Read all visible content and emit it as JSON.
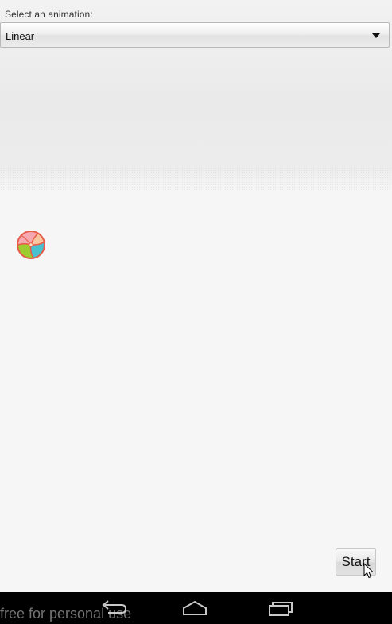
{
  "select": {
    "label": "Select an animation:",
    "value": "Linear",
    "icon": "chevron-down-icon"
  },
  "ball": {
    "icon": "beach-ball-icon"
  },
  "button": {
    "start_label": "Start"
  },
  "navbar": {
    "back_icon": "back-icon",
    "home_icon": "home-icon",
    "recent_icon": "recent-apps-icon"
  },
  "watermark": {
    "text": "free for personal use"
  },
  "colors": {
    "background": "#f6f6f6",
    "navbar": "#000000",
    "ball_red": "#e85c4a",
    "ball_pink": "#f6a8b0",
    "ball_green": "#9ccc2f",
    "ball_cyan": "#49c1cf"
  }
}
